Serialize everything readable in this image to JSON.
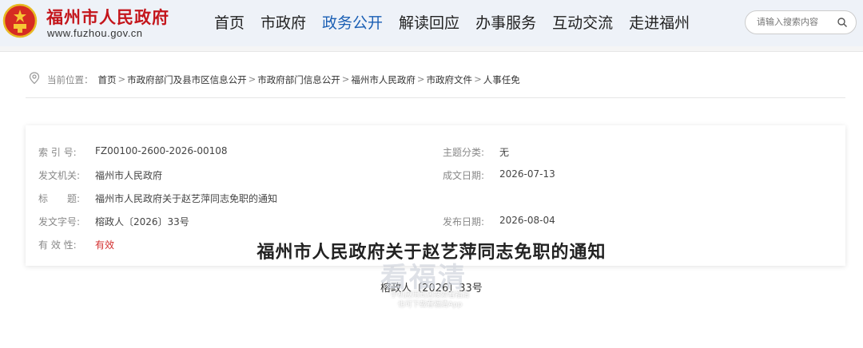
{
  "header": {
    "site_name": "福州市人民政府",
    "site_url": "www.fuzhou.gov.cn",
    "nav": [
      {
        "label": "首页",
        "active": false
      },
      {
        "label": "市政府",
        "active": false
      },
      {
        "label": "政务公开",
        "active": true
      },
      {
        "label": "解读回应",
        "active": false
      },
      {
        "label": "办事服务",
        "active": false
      },
      {
        "label": "互动交流",
        "active": false
      },
      {
        "label": "走进福州",
        "active": false
      }
    ],
    "search": {
      "placeholder": "请输入搜索内容"
    }
  },
  "breadcrumb": {
    "label": "当前位置：",
    "items": [
      "首页",
      "市政府部门及县市区信息公开",
      "市政府部门信息公开",
      "福州市人民政府",
      "市政府文件",
      "人事任免"
    ],
    "separator": ">"
  },
  "info": {
    "index_label": "索 引 号:",
    "index_value": "FZ00100-2600-2026-00108",
    "topic_label": "主题分类:",
    "topic_value": "无",
    "issuer_label": "发文机关:",
    "issuer_value": "福州市人民政府",
    "date_label": "成文日期:",
    "date_value": "2026-07-13",
    "title_label": "标　　题:",
    "title_value": "福州市人民政府关于赵艺萍同志免职的通知",
    "docno_label": "发文字号:",
    "docno_value": "榕政人〔2026〕33号",
    "publish_label": "发布日期:",
    "publish_value": "2026-08-04",
    "validity_label": "有 效 性:",
    "validity_value": "有效"
  },
  "document": {
    "title": "福州市人民政府关于赵艺萍同志免职的通知",
    "number": "榕政人〔2026〕33号"
  },
  "watermark": {
    "big": "看福清",
    "line1": "手机应用商店搜索看福清",
    "line2": "也可下载看福清App"
  },
  "colors": {
    "brand_red": "#c4161c",
    "nav_active": "#1a5fb4",
    "validity_red": "#d32f2f"
  }
}
